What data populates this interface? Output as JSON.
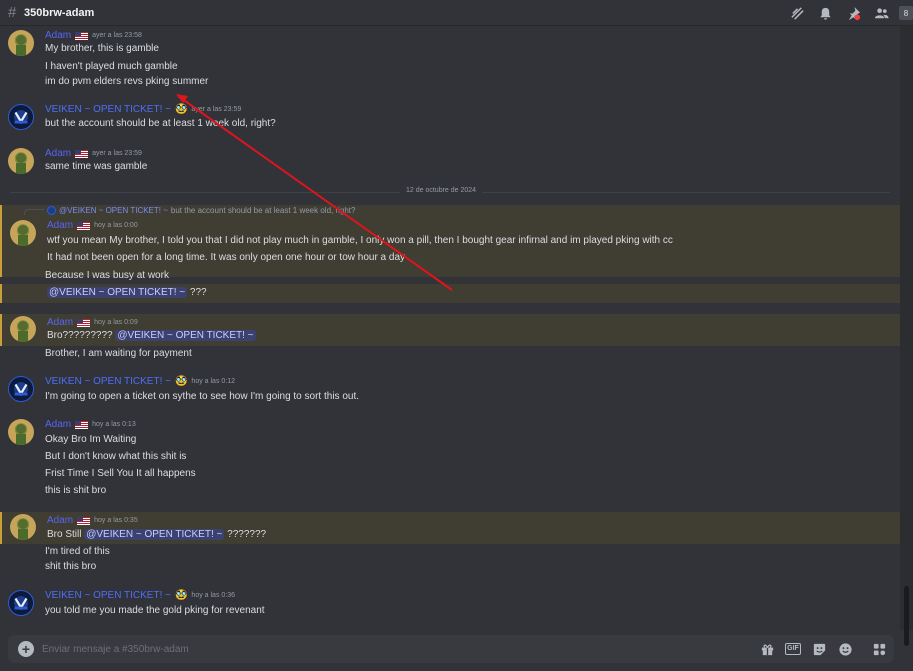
{
  "channel": {
    "name": "350brw-adam"
  },
  "header": {
    "badge": "8"
  },
  "date_divider": "12 de octubre de 2024",
  "messages": [
    {
      "author": "Adam",
      "time": "ayer a las 23:58",
      "lines": [
        "My brother, this is gamble",
        "I haven't played much gamble",
        "im do pvm elders revs pking summer"
      ]
    },
    {
      "author": "VEIKEN ~ OPEN TICKET! ~",
      "time": "ayer a las 23:59",
      "lines": [
        "but the account should be at least 1 week old, right?"
      ]
    },
    {
      "author": "Adam",
      "time": "ayer a las 23:59",
      "lines": [
        "same time was gamble"
      ]
    },
    {
      "reply_name": "@VEIKEN ~ OPEN TICKET! ~",
      "reply_text": "but the account should be at least 1 week old, right?",
      "author": "Adam",
      "time": "hoy a las 0:00",
      "lines": [
        "wtf you mean My brother, I told you that I did not play much in gamble, I only won a pill, then I bought gear infirnal and im played pking with cc",
        "It had not been open for a long time. It was only open one hour or tow hour a day",
        "Because I was busy at work"
      ],
      "mention_line": {
        "mention": "@VEIKEN ~ OPEN TICKET! ~",
        "text": " ???"
      }
    },
    {
      "author": "Adam",
      "time": "hoy a las 0:09",
      "prefix": "Bro?????????",
      "mention": "@VEIKEN ~ OPEN TICKET! ~",
      "lines": [
        "Brother, I am waiting for payment"
      ]
    },
    {
      "author": "VEIKEN ~ OPEN TICKET! ~",
      "time": "hoy a las 0:12",
      "lines": [
        "I'm going to open a ticket on sythe to see how I'm going to sort this out."
      ]
    },
    {
      "author": "Adam",
      "time": "hoy a las 0:13",
      "lines": [
        "Okay Bro Im Waiting",
        "But I don't know what this shit is",
        "Frist Time I Sell You It all happens",
        "this is shit bro"
      ]
    },
    {
      "author": "Adam",
      "time": "hoy a las 0:35",
      "prefix": "Bro Still",
      "mention": "@VEIKEN ~ OPEN TICKET! ~",
      "suffix": " ???????",
      "lines": [
        "I'm tired of this",
        "shit this bro"
      ]
    },
    {
      "author": "VEIKEN ~ OPEN TICKET! ~",
      "time": "hoy a las 0:36",
      "lines": [
        "you told me you made the gold pking for revenant"
      ]
    }
  ],
  "composer": {
    "placeholder": "Enviar mensaje a #350brw-adam"
  },
  "colors": {
    "annotation_arrow": "#e0141c",
    "mention_bg": "#3c4270",
    "highlight_bg": "#403d33"
  }
}
